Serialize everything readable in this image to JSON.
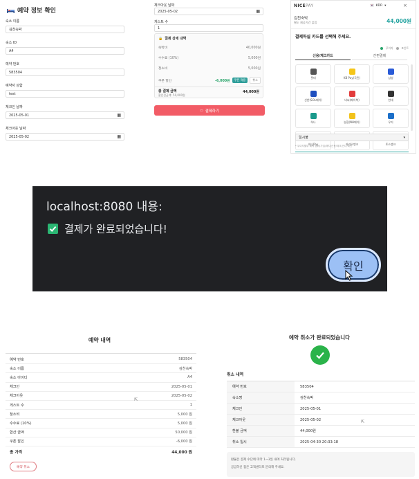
{
  "reservation_confirm": {
    "title": "예약 정보 확인",
    "fields": [
      {
        "label": "숙소 이름",
        "value": "김천숙박"
      },
      {
        "label": "숙소 ID",
        "value": "A4"
      },
      {
        "label": "예약 번호",
        "value": "583504"
      },
      {
        "label": "예약자 성함",
        "value": "test"
      },
      {
        "label": "체크인 날짜",
        "value": "2025-05-01"
      },
      {
        "label": "체크아웃 날짜",
        "value": "2025-05-02"
      }
    ]
  },
  "payment_detail": {
    "checkout_label": "체크아웃 날짜",
    "checkout_value": "2025-05-02",
    "guests_label": "게스트 수",
    "guests_value": "1",
    "section_title": "결제 상세 내역",
    "rows": [
      {
        "label": "숙박비",
        "value": "40,000원"
      },
      {
        "label": "수수료 (10%)",
        "value": "5,000원"
      },
      {
        "label": "청소비",
        "value": "5,000원"
      }
    ],
    "coupon_label": "쿠폰 할인",
    "coupon_value": "-6,000원",
    "coupon_apply": "쿠폰 적용",
    "coupon_cancel": "취소",
    "total_label": "총 결제 금액",
    "total_sub": "할인전금액: 50,000원",
    "total_value": "44,000원",
    "pay_button": "결제하기"
  },
  "nicepay": {
    "brand": "NICE",
    "brand_suffix": "PAY",
    "currency": "KDR",
    "shop": "김천숙박",
    "shop_sub": "별도 제공기간 없음",
    "amount": "44,000원",
    "prompt": "결제하실 카드를 선택해 주세요.",
    "legend1": "무이자",
    "legend2": "포인트",
    "tab1": "신용/체크카드",
    "tab2": "간편결제",
    "cards": [
      {
        "name": "롯데",
        "color": "#555555"
      },
      {
        "name": "KB Pay(국민)",
        "color": "#f5c518"
      },
      {
        "name": "삼성",
        "color": "#2a5bd7"
      },
      {
        "name": "신한(SOL페이)",
        "color": "#1f4fbf"
      },
      {
        "name": "비씨(페이북)",
        "color": "#e23b3b"
      },
      {
        "name": "현대",
        "color": "#333333"
      },
      {
        "name": "하나",
        "color": "#1a9a8c"
      },
      {
        "name": "농협(NH페이)",
        "color": "#f2c21b"
      },
      {
        "name": "우리",
        "color": "#1c6fc9"
      },
      {
        "name": "하나Pay",
        "color": "#12a08f"
      },
      {
        "name": "카카오뱅크",
        "color": "#f7d81e"
      },
      {
        "name": "토스뱅크",
        "color": "#1f5fe0"
      }
    ],
    "installment": "일시불",
    "notice": "* 무이자할부 혜택 범위(가입/해지/신용/체크)안내 확인"
  },
  "dialog": {
    "origin": "localhost:8080 내용:",
    "message": "결제가 완료되었습니다!",
    "ok": "확인"
  },
  "reservation_detail": {
    "title": "예약 내역",
    "rows": [
      {
        "label": "예약 번호",
        "value": "583504"
      },
      {
        "label": "숙소 이름",
        "value": "김천숙박"
      },
      {
        "label": "숙소 아이디",
        "value": "A4"
      },
      {
        "label": "체크인",
        "value": "2025-05-01"
      },
      {
        "label": "체크아웃",
        "value": "2025-05-02"
      },
      {
        "label": "게스트 수",
        "value": "1"
      },
      {
        "label": "청소비",
        "value": "5,000 원"
      },
      {
        "label": "수수료 (10%)",
        "value": "5,000 원"
      },
      {
        "label": "합산 금액",
        "value": "50,000 원"
      },
      {
        "label": "쿠폰 할인",
        "value": "-6,000 원"
      }
    ],
    "total_label": "총 가격",
    "total_value": "44,000 원",
    "cancel_button": "예약 취소"
  },
  "cancel_done": {
    "title": "예약 취소가 완료되었습니다",
    "section": "취소 내역",
    "rows": [
      {
        "label": "예약 번호",
        "value": "583504"
      },
      {
        "label": "숙소명",
        "value": "김천숙박"
      },
      {
        "label": "체크인",
        "value": "2025-05-01"
      },
      {
        "label": "체크아웃",
        "value": "2025-05-02"
      },
      {
        "label": "환불 금액",
        "value": "44,000원"
      },
      {
        "label": "취소 일시",
        "value": "2025-04-30 20:33:18"
      }
    ],
    "notice1": "환불은 결제 수단에 따라 1~3일 내에 처리됩니다.",
    "notice2": "궁금하신 점은 고객센터로 문의해 주세요."
  }
}
